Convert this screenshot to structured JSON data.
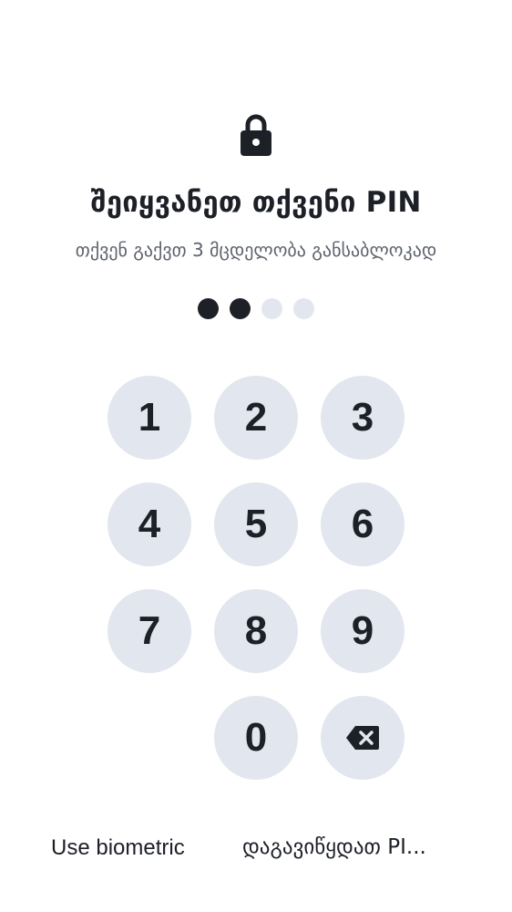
{
  "header": {
    "icon": "lock-icon",
    "title": "შეიყვანეთ თქვენი PIN",
    "subtitle": "თქვენ გაქვთ 3 მცდელობა განსაბლოკად"
  },
  "pin": {
    "length": 4,
    "entered": 2
  },
  "keypad": {
    "k1": "1",
    "k2": "2",
    "k3": "3",
    "k4": "4",
    "k5": "5",
    "k6": "6",
    "k7": "7",
    "k8": "8",
    "k9": "9",
    "k0": "0",
    "backspace_icon": "backspace-icon"
  },
  "footer": {
    "biometric_label": "Use biometric",
    "forgot_label": "დაგავიწყდათ PI..."
  },
  "colors": {
    "text": "#1d2027",
    "muted": "#5d626c",
    "key_bg": "#e2e6ee",
    "background": "#ffffff"
  }
}
